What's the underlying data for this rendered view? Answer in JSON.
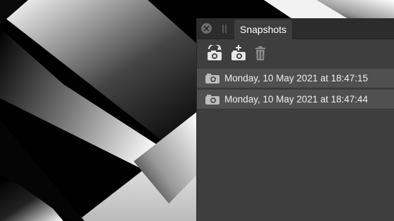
{
  "panel": {
    "tab_label": "Snapshots",
    "close_symbol": "✕"
  },
  "toolbar": {
    "icons": [
      "restore-snapshot-icon",
      "add-snapshot-icon",
      "delete-snapshot-icon"
    ]
  },
  "snapshots": [
    {
      "label": "Monday, 10 May 2021 at 18:47:15",
      "icon": "camera-icon"
    },
    {
      "label": "Monday, 10 May 2021 at 18:47:44",
      "icon": "camera-icon"
    }
  ],
  "colors": {
    "panel_bg": "#3e3e3e",
    "header_bg": "#2c2c2c",
    "row_bg": "#505050",
    "icon": "#e6e6e6"
  }
}
